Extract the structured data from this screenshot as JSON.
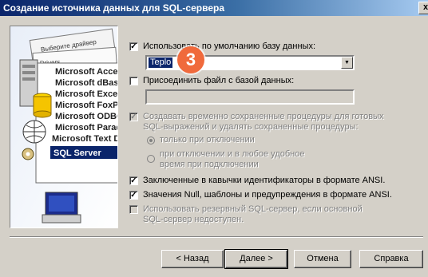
{
  "window": {
    "title": "Создание источника данных для SQL-сервера",
    "close_label": "x"
  },
  "illustration": {
    "driver_list": [
      "Выберите драйвер",
      "Drivers",
      "Microsoft Access Driver",
      "Microsoft dBase Driver",
      "Microsoft Excel Driver",
      "Microsoft FoxPro Driver",
      "Microsoft ODBC for Oracle",
      "Microsoft Paradox Driver",
      "Microsoft Text Driver",
      "SQL Server"
    ]
  },
  "options": {
    "default_db": {
      "label": "Использовать по умолчанию базу данных:",
      "checked": true
    },
    "default_db_value": "Teplo",
    "attach_file": {
      "label": "Присоединить файл с базой данных:",
      "checked": false
    },
    "temp_procs": {
      "label": "Создавать временно сохраненные процедуры для готовых SQL-выражений и удалять сохраненные процедуры:",
      "checked": true,
      "enabled": false
    },
    "radio_disconnect": {
      "label": "только при отключении",
      "checked": true
    },
    "radio_any": {
      "label": "при отключении и в любое удобное время при подключении",
      "checked": false
    },
    "quoted_ids": {
      "label": "Заключенные в кавычки идентификаторы в формате ANSI.",
      "checked": true
    },
    "ansi_nulls": {
      "label": "Значения Null, шаблоны и предупреждения в формате ANSI.",
      "checked": true
    },
    "failover": {
      "label": "Использовать резервный SQL-сервер, если основной SQL-сервер недоступен.",
      "checked": false,
      "enabled": false
    }
  },
  "step_badge": "3",
  "buttons": {
    "back": "< Назад",
    "next": "Далее >",
    "cancel": "Отмена",
    "help": "Справка"
  },
  "colors": {
    "titlebar_start": "#0a246a",
    "titlebar_end": "#a6caf0",
    "badge": "#f06a3c",
    "face": "#d4d0c8"
  }
}
